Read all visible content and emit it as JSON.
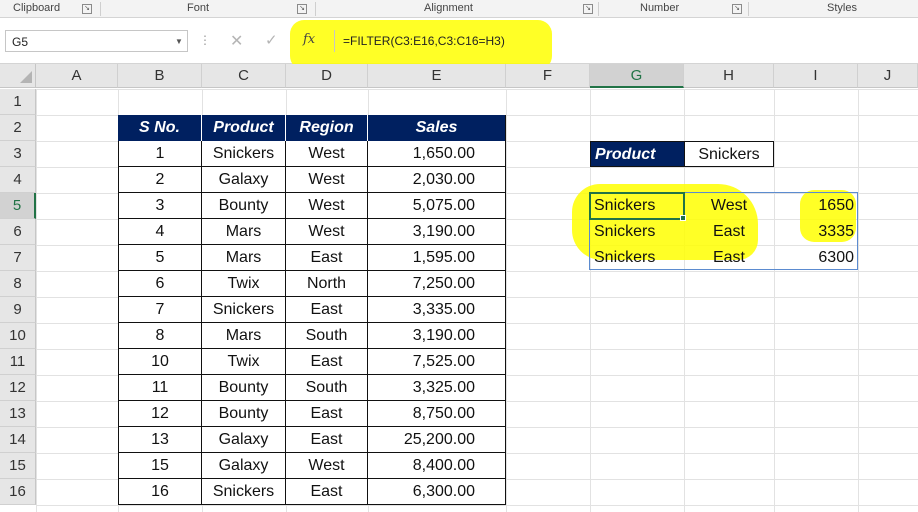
{
  "ribbon": {
    "groups": [
      "Clipboard",
      "Font",
      "Alignment",
      "Number",
      "Styles"
    ]
  },
  "formula_bar": {
    "name_box": "G5",
    "formula": "=FILTER(C3:E16,C3:C16=H3)",
    "fx_label": "fx",
    "cancel_glyph": "✕",
    "enter_glyph": "✓",
    "dots_glyph": "⋮"
  },
  "columns": [
    "A",
    "B",
    "C",
    "D",
    "E",
    "F",
    "G",
    "H",
    "I",
    "J"
  ],
  "rows": [
    "1",
    "2",
    "3",
    "4",
    "5",
    "6",
    "7",
    "8",
    "9",
    "10",
    "11",
    "12",
    "13",
    "14",
    "15",
    "16"
  ],
  "table": {
    "headers": [
      "S No.",
      "Product",
      "Region",
      "Sales"
    ],
    "rows": [
      [
        "1",
        "Snickers",
        "West",
        "1,650.00"
      ],
      [
        "2",
        "Galaxy",
        "West",
        "2,030.00"
      ],
      [
        "3",
        "Bounty",
        "West",
        "5,075.00"
      ],
      [
        "4",
        "Mars",
        "West",
        "3,190.00"
      ],
      [
        "5",
        "Mars",
        "East",
        "1,595.00"
      ],
      [
        "6",
        "Twix",
        "North",
        "7,250.00"
      ],
      [
        "7",
        "Snickers",
        "East",
        "3,335.00"
      ],
      [
        "8",
        "Mars",
        "South",
        "3,190.00"
      ],
      [
        "10",
        "Twix",
        "East",
        "7,525.00"
      ],
      [
        "11",
        "Bounty",
        "South",
        "3,325.00"
      ],
      [
        "12",
        "Bounty",
        "East",
        "8,750.00"
      ],
      [
        "13",
        "Galaxy",
        "East",
        "25,200.00"
      ],
      [
        "15",
        "Galaxy",
        "West",
        "8,400.00"
      ],
      [
        "16",
        "Snickers",
        "East",
        "6,300.00"
      ]
    ]
  },
  "lookup": {
    "label": "Product",
    "value": "Snickers"
  },
  "result": {
    "rows": [
      [
        "Snickers",
        "West",
        "1650"
      ],
      [
        "Snickers",
        "East",
        "3335"
      ],
      [
        "Snickers",
        "East",
        "6300"
      ]
    ]
  },
  "colors": {
    "header_fill": "#002060",
    "highlight": "#ffff00",
    "excel_green": "#217346",
    "spill_border": "#5b8bd0"
  },
  "icons": [
    "dialog-launcher-icon",
    "dropdown-arrow-icon",
    "cancel-icon",
    "enter-icon",
    "fx-icon",
    "select-all-icon"
  ]
}
